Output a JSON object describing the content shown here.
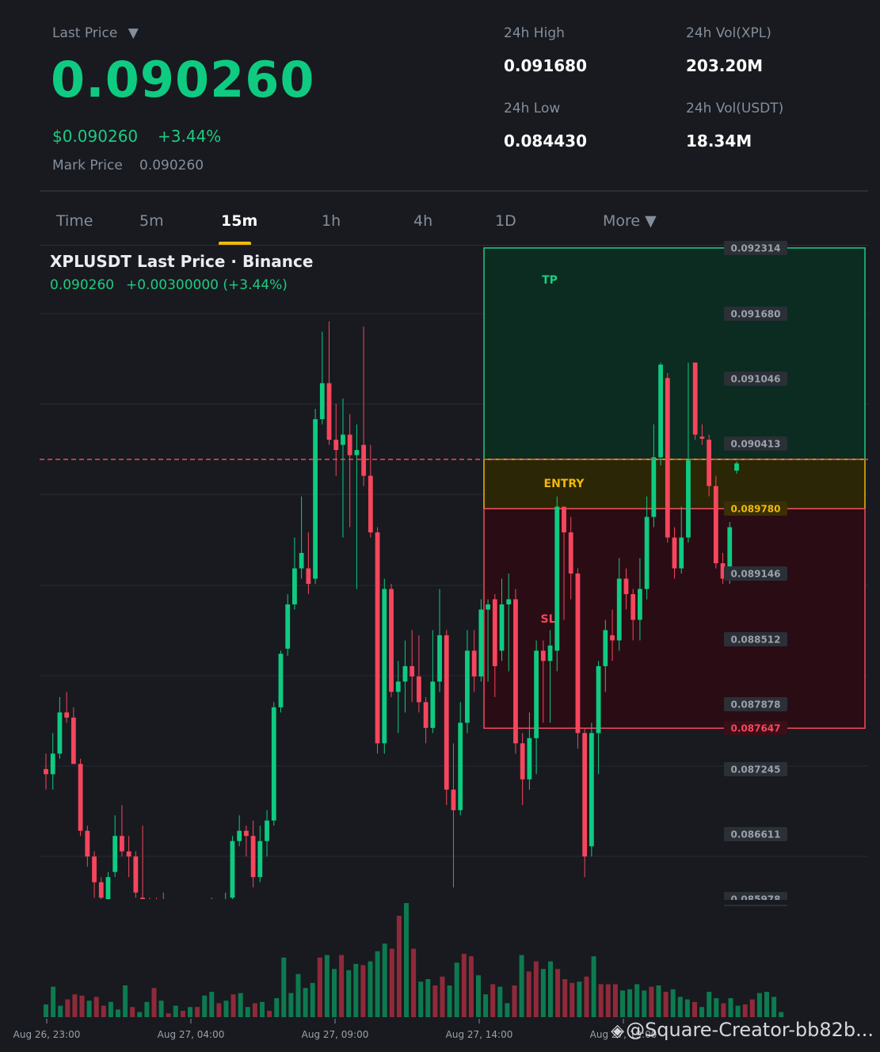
{
  "ticker": {
    "last_price_label": "Last Price",
    "dropdown_glyph": "▼",
    "last_price": "0.090260",
    "usd_price": "$0.090260",
    "change_pct": "+3.44%",
    "mark_price_label": "Mark Price",
    "mark_price": "0.090260"
  },
  "stats": {
    "high_label": "24h High",
    "high_value": "0.091680",
    "low_label": "24h Low",
    "low_value": "0.084430",
    "vol_base_label": "24h Vol(XPL)",
    "vol_base_value": "203.20M",
    "vol_quote_label": "24h Vol(USDT)",
    "vol_quote_value": "18.34M"
  },
  "tabs": [
    {
      "label": "Time"
    },
    {
      "label": "5m"
    },
    {
      "label": "15m",
      "active": true
    },
    {
      "label": "1h"
    },
    {
      "label": "4h"
    },
    {
      "label": "1D"
    },
    {
      "label": "More ▼"
    }
  ],
  "chart_header": {
    "title": "XPLUSDT Last Price · Binance",
    "price": "0.090260",
    "change": "+0.00300000 (+3.44%)"
  },
  "chart_data": {
    "type": "candlestick",
    "price_ticks": [
      "0.092314",
      "0.091680",
      "0.091046",
      "0.090413",
      "0.089780",
      "0.089146",
      "0.088512",
      "0.087878",
      "0.087647",
      "0.087245",
      "0.086611",
      "0.085978"
    ],
    "highlighted_ticks": {
      "entry": "0.089780",
      "stop_loss": "0.087647"
    },
    "time_ticks": [
      "Aug 26, 23:00",
      "Aug 27, 04:00",
      "Aug 27, 09:00",
      "Aug 27, 14:00",
      "Aug 27, 19:00"
    ],
    "current_price_line": 0.09026,
    "zones": [
      {
        "label": "TP",
        "top": 0.092314,
        "bottom": 0.09026,
        "color": "#0c2b21",
        "border": "#1ecb82",
        "text": "#1ecb82"
      },
      {
        "label": "ENTRY",
        "top": 0.09026,
        "bottom": 0.08978,
        "color": "#2b2605",
        "border": "#f0b90b",
        "text": "#f0b90b"
      },
      {
        "label": "SL",
        "top": 0.08978,
        "bottom": 0.087647,
        "color": "#2a0c14",
        "border": "#f6465d",
        "text": "#f6465d"
      }
    ],
    "colors": {
      "up": "#0ecb81",
      "down": "#f6465d",
      "vol_up": "#0d7a50",
      "vol_down": "#8f2a3a",
      "grid": "#262a31"
    },
    "candles": [
      [
        0.08725,
        0.0872,
        0.0874,
        0.08705
      ],
      [
        0.0872,
        0.0874,
        0.0876,
        0.08705
      ],
      [
        0.0874,
        0.0878,
        0.08795,
        0.08735
      ],
      [
        0.0878,
        0.08775,
        0.088,
        0.0877
      ],
      [
        0.08775,
        0.0873,
        0.08785,
        0.0873
      ],
      [
        0.0873,
        0.08665,
        0.08735,
        0.0866
      ],
      [
        0.08665,
        0.0864,
        0.0867,
        0.0863
      ],
      [
        0.0864,
        0.08615,
        0.08645,
        0.086
      ],
      [
        0.08615,
        0.086,
        0.0862,
        0.0859
      ],
      [
        0.08595,
        0.0862,
        0.08625,
        0.0859
      ],
      [
        0.08625,
        0.0866,
        0.0868,
        0.0862
      ],
      [
        0.0866,
        0.08645,
        0.0869,
        0.0864
      ],
      [
        0.08645,
        0.0864,
        0.0866,
        0.0862
      ],
      [
        0.0864,
        0.08605,
        0.08645,
        0.086
      ],
      [
        0.086,
        0.08595,
        0.0867,
        0.0859
      ],
      [
        0.08595,
        0.0859,
        0.086,
        0.0858
      ],
      [
        0.0859,
        0.08588,
        0.086,
        0.0857
      ],
      [
        0.08588,
        0.08575,
        0.08605,
        0.0857
      ],
      [
        0.08575,
        0.0857,
        0.0858,
        0.0856
      ],
      [
        0.0857,
        0.08565,
        0.08575,
        0.08555
      ],
      [
        0.08565,
        0.0857,
        0.0858,
        0.08555
      ],
      [
        0.0857,
        0.08568,
        0.08575,
        0.0856
      ],
      [
        0.08568,
        0.08575,
        0.08585,
        0.0856
      ],
      [
        0.08575,
        0.0858,
        0.0859,
        0.0857
      ],
      [
        0.0858,
        0.08585,
        0.086,
        0.08575
      ],
      [
        0.08585,
        0.08585,
        0.08595,
        0.0857
      ],
      [
        0.08585,
        0.08595,
        0.08605,
        0.0858
      ],
      [
        0.086,
        0.08655,
        0.0866,
        0.08595
      ],
      [
        0.08655,
        0.08665,
        0.0868,
        0.0865
      ],
      [
        0.08665,
        0.0866,
        0.0867,
        0.0864
      ],
      [
        0.0866,
        0.0862,
        0.08675,
        0.0861
      ],
      [
        0.0862,
        0.08655,
        0.0867,
        0.08615
      ],
      [
        0.08655,
        0.08675,
        0.08685,
        0.0864
      ],
      [
        0.08675,
        0.08785,
        0.0879,
        0.0867
      ],
      [
        0.08785,
        0.08837,
        0.0884,
        0.0878
      ],
      [
        0.08842,
        0.08885,
        0.08895,
        0.08835
      ],
      [
        0.08885,
        0.0892,
        0.0895,
        0.0888
      ],
      [
        0.0892,
        0.08935,
        0.0899,
        0.0891
      ],
      [
        0.0892,
        0.08905,
        0.08955,
        0.08895
      ],
      [
        0.0891,
        0.09065,
        0.09075,
        0.08905
      ],
      [
        0.09065,
        0.091,
        0.0915,
        0.0906
      ],
      [
        0.091,
        0.09045,
        0.0916,
        0.0904
      ],
      [
        0.09045,
        0.09035,
        0.0908,
        0.0901
      ],
      [
        0.0904,
        0.0905,
        0.09085,
        0.0895
      ],
      [
        0.0905,
        0.0903,
        0.0907,
        0.0896
      ],
      [
        0.0903,
        0.09035,
        0.0906,
        0.089
      ],
      [
        0.0904,
        0.0901,
        0.09155,
        0.09
      ],
      [
        0.0901,
        0.08955,
        0.0904,
        0.0895
      ],
      [
        0.08955,
        0.0875,
        0.0896,
        0.0874
      ],
      [
        0.0875,
        0.089,
        0.0891,
        0.0874
      ],
      [
        0.089,
        0.088,
        0.08905,
        0.08795
      ],
      [
        0.088,
        0.0881,
        0.0883,
        0.0876
      ],
      [
        0.0881,
        0.08825,
        0.0885,
        0.0878
      ],
      [
        0.08825,
        0.08815,
        0.0886,
        0.0879
      ],
      [
        0.08815,
        0.0879,
        0.08855,
        0.0878
      ],
      [
        0.0879,
        0.08765,
        0.08795,
        0.0875
      ],
      [
        0.08765,
        0.0881,
        0.0886,
        0.0876
      ],
      [
        0.0881,
        0.08855,
        0.089,
        0.088
      ],
      [
        0.08855,
        0.08705,
        0.0886,
        0.0869
      ],
      [
        0.08705,
        0.08685,
        0.0875,
        0.0861
      ],
      [
        0.08685,
        0.0877,
        0.0879,
        0.0868
      ],
      [
        0.0877,
        0.0884,
        0.0886,
        0.0876
      ],
      [
        0.0884,
        0.08815,
        0.0886,
        0.088
      ],
      [
        0.08815,
        0.0888,
        0.0889,
        0.0881
      ],
      [
        0.0888,
        0.08885,
        0.0889,
        0.0881
      ],
      [
        0.0889,
        0.08825,
        0.08895,
        0.08795
      ],
      [
        0.0884,
        0.08885,
        0.0891,
        0.0883
      ],
      [
        0.08885,
        0.0889,
        0.08915,
        0.0882
      ],
      [
        0.0889,
        0.0875,
        0.089,
        0.0874
      ],
      [
        0.0875,
        0.08715,
        0.0876,
        0.0869
      ],
      [
        0.08715,
        0.08755,
        0.0878,
        0.08705
      ],
      [
        0.08755,
        0.0884,
        0.0885,
        0.0872
      ],
      [
        0.0884,
        0.0883,
        0.0885,
        0.0877
      ],
      [
        0.0883,
        0.08845,
        0.0886,
        0.0877
      ],
      [
        0.0884,
        0.0898,
        0.0899,
        0.0882
      ],
      [
        0.0898,
        0.08955,
        0.0898,
        0.0887
      ],
      [
        0.08955,
        0.08915,
        0.0897,
        0.0889
      ],
      [
        0.08915,
        0.0876,
        0.0892,
        0.08745
      ],
      [
        0.0876,
        0.0864,
        0.08765,
        0.0862
      ],
      [
        0.0865,
        0.0876,
        0.0877,
        0.0864
      ],
      [
        0.0876,
        0.08825,
        0.0883,
        0.0872
      ],
      [
        0.08825,
        0.0886,
        0.0887,
        0.088
      ],
      [
        0.08855,
        0.0885,
        0.0888,
        0.0883
      ],
      [
        0.0885,
        0.0891,
        0.0893,
        0.0884
      ],
      [
        0.0891,
        0.08895,
        0.0892,
        0.0888
      ],
      [
        0.08895,
        0.0887,
        0.089,
        0.0885
      ],
      [
        0.0887,
        0.089,
        0.0893,
        0.0885
      ],
      [
        0.089,
        0.0897,
        0.0899,
        0.0889
      ],
      [
        0.0897,
        0.09028,
        0.0906,
        0.0896
      ],
      [
        0.09028,
        0.09118,
        0.0912,
        0.0902
      ],
      [
        0.09105,
        0.0895,
        0.0911,
        0.08945
      ],
      [
        0.0895,
        0.0892,
        0.0896,
        0.0891
      ],
      [
        0.0892,
        0.0895,
        0.0898,
        0.08915
      ],
      [
        0.0895,
        0.09025,
        0.0912,
        0.08945
      ],
      [
        0.0912,
        0.0905,
        0.0912,
        0.09045
      ],
      [
        0.09048,
        0.09046,
        0.0906,
        0.0904
      ],
      [
        0.09045,
        0.09,
        0.0905,
        0.0899
      ],
      [
        0.09,
        0.08925,
        0.0901,
        0.0892
      ],
      [
        0.08925,
        0.0891,
        0.08935,
        0.08905
      ],
      [
        0.0891,
        0.0896,
        0.08965,
        0.08905
      ],
      [
        0.09015,
        0.09022,
        0.09024,
        0.09012
      ]
    ],
    "volumes": [
      10,
      24,
      9,
      14,
      18,
      17,
      13,
      16,
      9,
      12,
      6,
      25,
      8,
      4,
      12,
      23,
      13,
      3,
      9,
      5,
      8,
      8,
      17,
      20,
      11,
      13,
      18,
      19,
      8,
      11,
      12,
      5,
      15,
      47,
      19,
      34,
      23,
      27,
      47,
      49,
      38,
      49,
      37,
      42,
      41,
      44,
      52,
      58,
      54,
      80,
      90,
      54,
      28,
      30,
      25,
      32,
      25,
      43,
      50,
      48,
      33,
      18,
      26,
      24,
      11,
      25,
      49,
      36,
      44,
      38,
      44,
      38,
      30,
      27,
      28,
      32,
      48,
      26,
      26,
      26,
      21,
      22,
      26,
      21,
      24,
      25,
      20,
      22,
      16,
      14,
      12,
      8,
      20,
      15,
      11,
      15,
      9,
      10,
      14,
      19,
      20,
      16,
      4
    ],
    "volume_up": [
      1,
      1,
      1,
      0,
      0,
      0,
      1,
      0,
      0,
      1,
      1,
      1,
      0,
      1,
      1,
      0,
      1,
      0,
      1,
      0,
      1,
      0,
      1,
      1,
      0,
      1,
      0,
      1,
      1,
      0,
      1,
      0,
      1,
      1,
      1,
      1,
      1,
      1,
      0,
      1,
      1,
      0,
      1,
      1,
      0,
      1,
      1,
      1,
      0,
      0,
      1,
      0,
      1,
      1,
      0,
      0,
      1,
      1,
      0,
      0,
      1,
      1,
      0,
      1,
      1,
      0,
      1,
      0,
      0,
      1,
      1,
      0,
      0,
      0,
      1,
      0,
      1,
      0,
      0,
      0,
      1,
      1,
      1,
      1,
      0,
      1,
      0,
      1,
      1,
      1,
      0,
      1,
      1,
      1,
      0,
      1,
      1,
      0,
      0,
      1,
      1,
      1,
      1
    ]
  },
  "watermark": "@Square-Creator-bb82b..."
}
